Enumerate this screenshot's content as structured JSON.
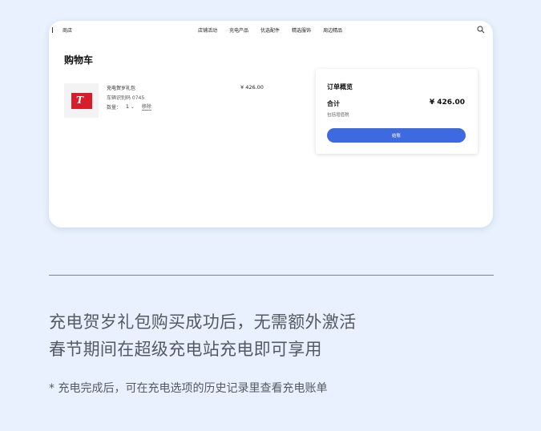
{
  "nav": {
    "brand": "商店",
    "links": [
      "店铺活动",
      "充电产品",
      "优选配件",
      "精选服饰",
      "周边精品"
    ]
  },
  "cart": {
    "title": "购物车",
    "item": {
      "name": "充电贺岁礼包",
      "id_text": "车辆识别码 0745",
      "qty_label": "数量：",
      "qty_value": "1",
      "remove_label": "移除",
      "price": "¥ 426.00"
    }
  },
  "summary": {
    "title": "订单概览",
    "total_label": "合计",
    "total_value": "¥ 426.00",
    "tax_note": "包括增值税",
    "checkout_label": "结账"
  },
  "promo": {
    "line1": "充电贺岁礼包购买成功后，无需额外激活",
    "line2": "春节期间在超级充电站充电即可享用",
    "note": "* 充电完成后，可在充电选项的历史记录里查看充电账单"
  },
  "icons": {
    "search": "search-icon",
    "product": "product-logo-icon",
    "chevron": "chevron-down-icon"
  },
  "colors": {
    "background": "#e8f1fd",
    "accent": "#3e6ae1",
    "product_red": "#d91c2a"
  }
}
